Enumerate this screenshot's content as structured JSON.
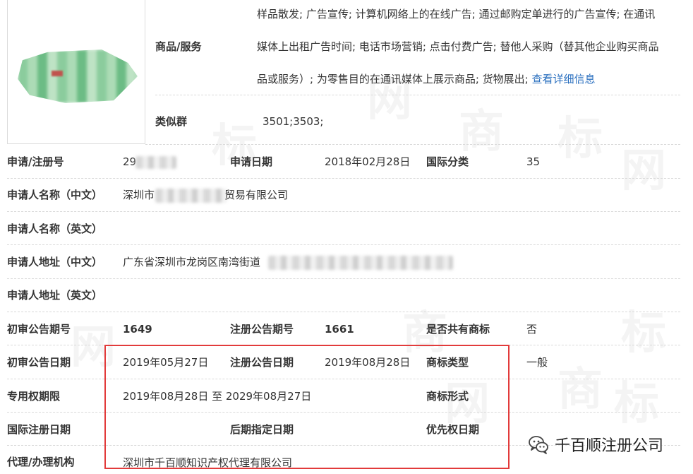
{
  "goods_services": {
    "label": "商品/服务",
    "lines": [
      "样品散发; 广告宣传; 计算机网络上的在线广告; 通过邮购定单进行的广告宣传; 在通讯",
      "媒体上出租广告时间; 电话市场营销; 点击付费广告; 替他人采购（替其他企业购买商品",
      "品或服务）; 为零售目的在通讯媒体上展示商品; 货物展出; "
    ],
    "detail_link": "查看详细信息"
  },
  "similar_group": {
    "label": "类似群",
    "value": "3501;3503;"
  },
  "fields": {
    "reg_no_label": "申请/注册号",
    "reg_no_value": "29",
    "apply_date_label": "申请日期",
    "apply_date_value": "2018年02月28日",
    "intl_class_label": "国际分类",
    "intl_class_value": "35",
    "applicant_cn_label": "申请人名称（中文）",
    "applicant_cn_prefix": "深圳市",
    "applicant_cn_suffix": "贸易有限公司",
    "applicant_en_label": "申请人名称（英文）",
    "address_cn_label": "申请人地址（中文）",
    "address_cn_value": "广东省深圳市龙岗区南湾街道",
    "address_en_label": "申请人地址（英文）",
    "prelim_issue_label": "初审公告期号",
    "prelim_issue_value": "1649",
    "reg_issue_label": "注册公告期号",
    "reg_issue_value": "1661",
    "shared_label": "是否共有商标",
    "shared_value": "否",
    "prelim_date_label": "初审公告日期",
    "prelim_date_value": "2019年05月27日",
    "reg_date_label": "注册公告日期",
    "reg_date_value": "2019年08月28日",
    "tm_type_label": "商标类型",
    "tm_type_value": "一般",
    "exclusive_label": "专用权期限",
    "exclusive_value": "2019年08月28日 至 2029年08月27日",
    "tm_form_label": "商标形式",
    "intl_reg_date_label": "国际注册日期",
    "later_designation_label": "后期指定日期",
    "priority_date_label": "优先权日期",
    "agent_label": "代理/办理机构",
    "agent_value": "深圳市千百顺知识产权代理有限公司"
  },
  "watermark": {
    "chars": [
      "商",
      "标",
      "网",
      "商",
      "标",
      "网",
      "商",
      "标",
      "网",
      "商",
      "标",
      "网"
    ]
  },
  "branding": {
    "wechat_name": "千百顺注册公司",
    "wechat_icon": "wechat-icon"
  },
  "colors": {
    "highlight_box": "#e23b3b",
    "link": "#2a6fbf"
  }
}
